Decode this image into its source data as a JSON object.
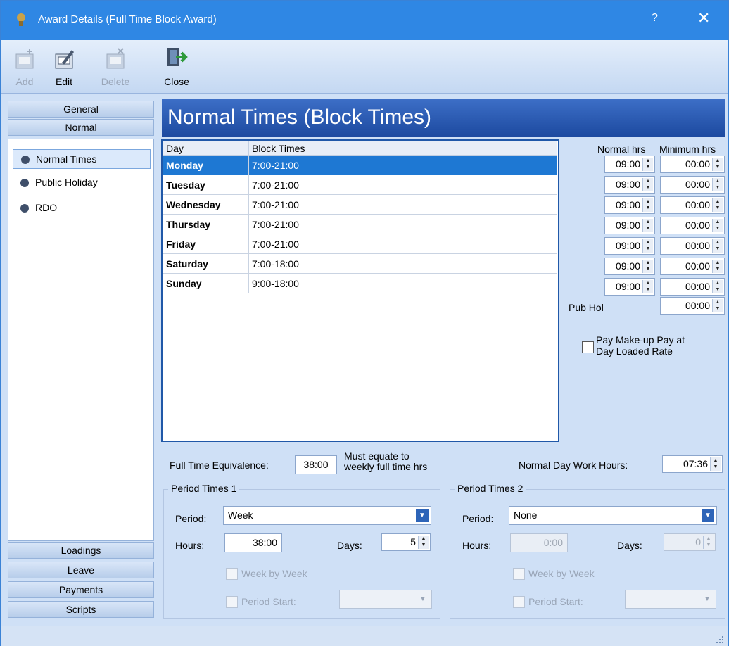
{
  "window": {
    "title": "Award Details (Full Time Block Award)",
    "help": "?",
    "close": "✕"
  },
  "toolbar": {
    "add": "Add",
    "edit": "Edit",
    "delete": "Delete",
    "close": "Close"
  },
  "nav": {
    "general": "General",
    "normal": "Normal",
    "items": [
      "Normal Times",
      "Public Holiday",
      "RDO"
    ],
    "loadings": "Loadings",
    "leave": "Leave",
    "payments": "Payments",
    "scripts": "Scripts"
  },
  "header": {
    "title": "Normal Times (Block Times)"
  },
  "grid": {
    "headers": [
      "Day",
      "Block Times"
    ],
    "rows": [
      {
        "day": "Monday",
        "block": "7:00-21:00"
      },
      {
        "day": "Tuesday",
        "block": "7:00-21:00"
      },
      {
        "day": "Wednesday",
        "block": "7:00-21:00"
      },
      {
        "day": "Thursday",
        "block": "7:00-21:00"
      },
      {
        "day": "Friday",
        "block": "7:00-21:00"
      },
      {
        "day": "Saturday",
        "block": "7:00-18:00"
      },
      {
        "day": "Sunday",
        "block": "9:00-18:00"
      }
    ]
  },
  "hours": {
    "normal_label": "Normal hrs",
    "minimum_label": "Minimum hrs",
    "normal": [
      "09:00",
      "09:00",
      "09:00",
      "09:00",
      "09:00",
      "09:00",
      "09:00"
    ],
    "minimum": [
      "00:00",
      "00:00",
      "00:00",
      "00:00",
      "00:00",
      "00:00",
      "00:00"
    ],
    "pubhol_label": "Pub Hol",
    "pubhol": "00:00",
    "makeup_line1": "Pay Make-up Pay at",
    "makeup_line2": "Day Loaded Rate"
  },
  "fte": {
    "label": "Full Time Equivalence:",
    "value": "38:00",
    "note1": "Must equate to",
    "note2": "weekly full time hrs",
    "ndwh_label": "Normal Day Work Hours:",
    "ndwh_value": "07:36"
  },
  "period1": {
    "title": "Period Times 1",
    "period_label": "Period:",
    "period": "Week",
    "hours_label": "Hours:",
    "hours": "38:00",
    "days_label": "Days:",
    "days": "5",
    "week_by_week": "Week by Week",
    "period_start": "Period Start:"
  },
  "period2": {
    "title": "Period Times 2",
    "period_label": "Period:",
    "period": "None",
    "hours_label": "Hours:",
    "hours": "0:00",
    "days_label": "Days:",
    "days": "0",
    "week_by_week": "Week by Week",
    "period_start": "Period Start:"
  }
}
